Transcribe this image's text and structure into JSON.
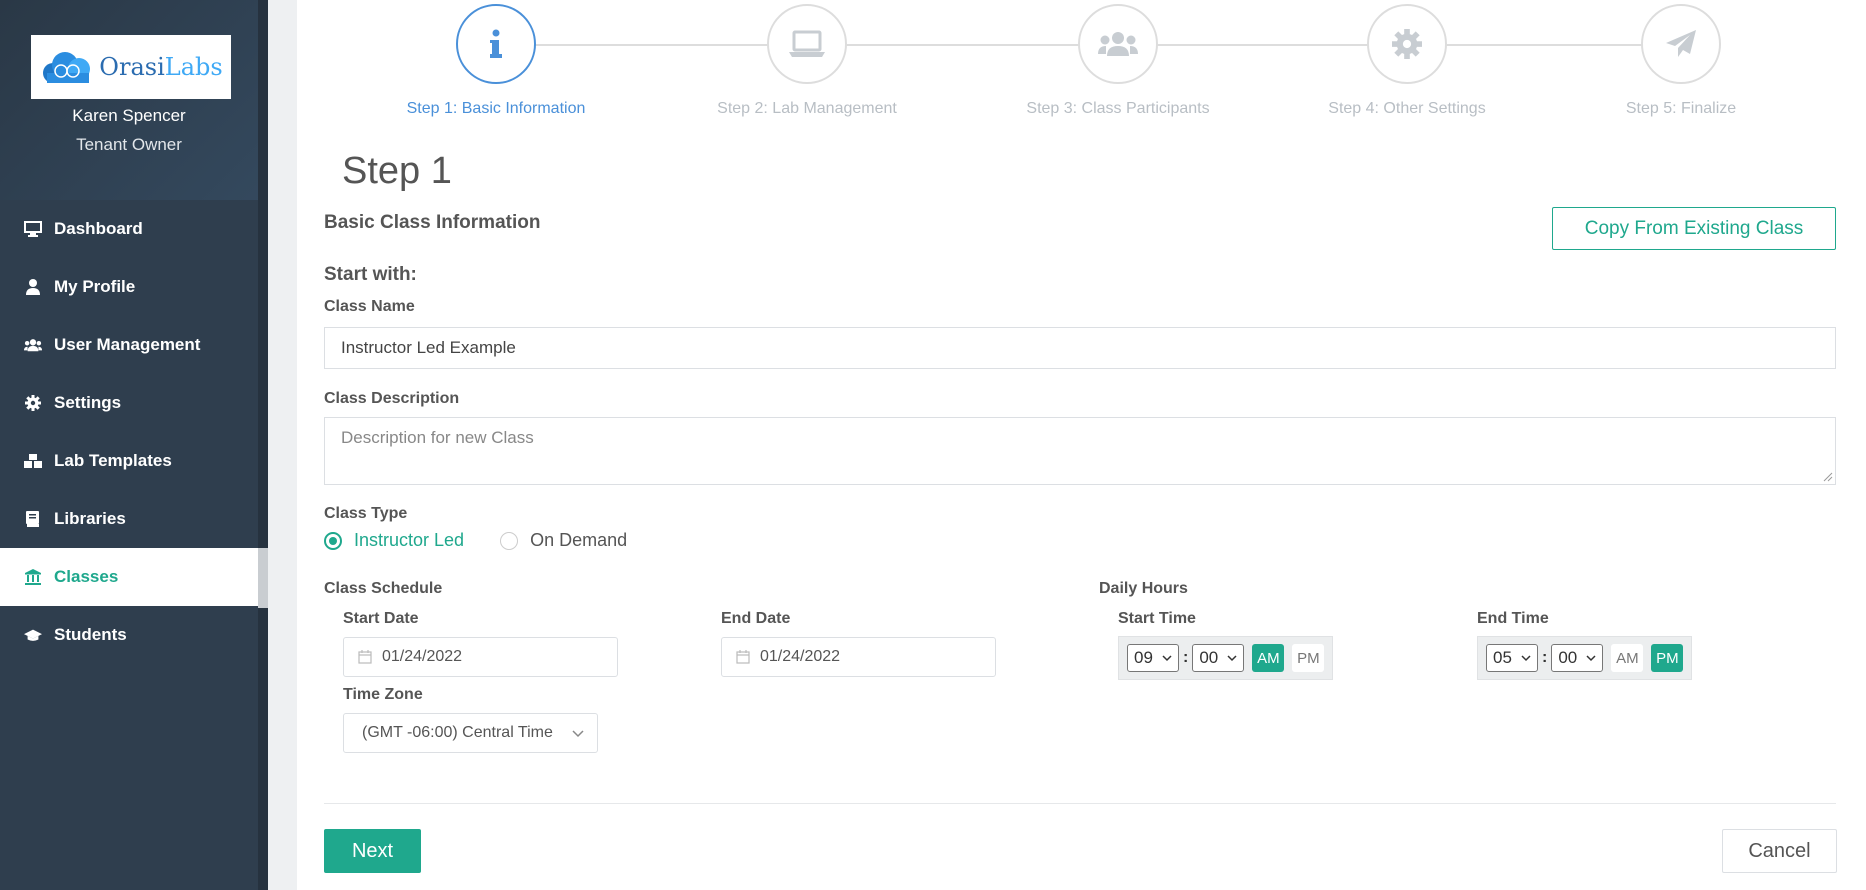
{
  "brand": {
    "logo_prefix": "Orasi",
    "logo_suffix": "Labs"
  },
  "user": {
    "name": "Karen Spencer",
    "role": "Tenant Owner"
  },
  "sidebar": {
    "items": [
      {
        "label": "Dashboard",
        "icon": "monitor-icon"
      },
      {
        "label": "My Profile",
        "icon": "user-icon"
      },
      {
        "label": "User Management",
        "icon": "users-icon"
      },
      {
        "label": "Settings",
        "icon": "gear-icon"
      },
      {
        "label": "Lab Templates",
        "icon": "cubes-icon"
      },
      {
        "label": "Libraries",
        "icon": "book-icon"
      },
      {
        "label": "Classes",
        "icon": "institution-icon",
        "active": true
      },
      {
        "label": "Students",
        "icon": "graduation-cap-icon"
      }
    ]
  },
  "steps": [
    {
      "label": "Step 1: Basic Information",
      "icon": "info-icon",
      "active": true
    },
    {
      "label": "Step 2: Lab Management",
      "icon": "laptop-icon"
    },
    {
      "label": "Step 3: Class Participants",
      "icon": "users-icon"
    },
    {
      "label": "Step 4: Other Settings",
      "icon": "gear-icon"
    },
    {
      "label": "Step 5: Finalize",
      "icon": "paper-plane-icon"
    }
  ],
  "form": {
    "step_title": "Step 1",
    "section_title": "Basic Class Information",
    "copy_button": "Copy From Existing Class",
    "start_with": "Start with:",
    "class_name_label": "Class Name",
    "class_name_value": "Instructor Led Example",
    "class_description_label": "Class Description",
    "class_description_placeholder": "Description for new Class",
    "class_type_label": "Class Type",
    "class_type_options": [
      "Instructor Led",
      "On Demand"
    ],
    "class_type_selected": "Instructor Led",
    "class_schedule_label": "Class Schedule",
    "start_date_label": "Start Date",
    "start_date_value": "01/24/2022",
    "end_date_label": "End Date",
    "end_date_value": "01/24/2022",
    "time_zone_label": "Time Zone",
    "time_zone_value": "(GMT -06:00) Central Time",
    "daily_hours_label": "Daily Hours",
    "start_time_label": "Start Time",
    "start_time": {
      "hour": "09",
      "minute": "00",
      "am": "AM",
      "pm": "PM",
      "selected": "AM"
    },
    "end_time_label": "End Time",
    "end_time": {
      "hour": "05",
      "minute": "00",
      "am": "AM",
      "pm": "PM",
      "selected": "PM"
    },
    "next_button": "Next",
    "cancel_button": "Cancel"
  },
  "colors": {
    "accent": "#1fa88d",
    "sidebar_bg": "#2f3e4e",
    "step_active": "#4a90d9"
  }
}
